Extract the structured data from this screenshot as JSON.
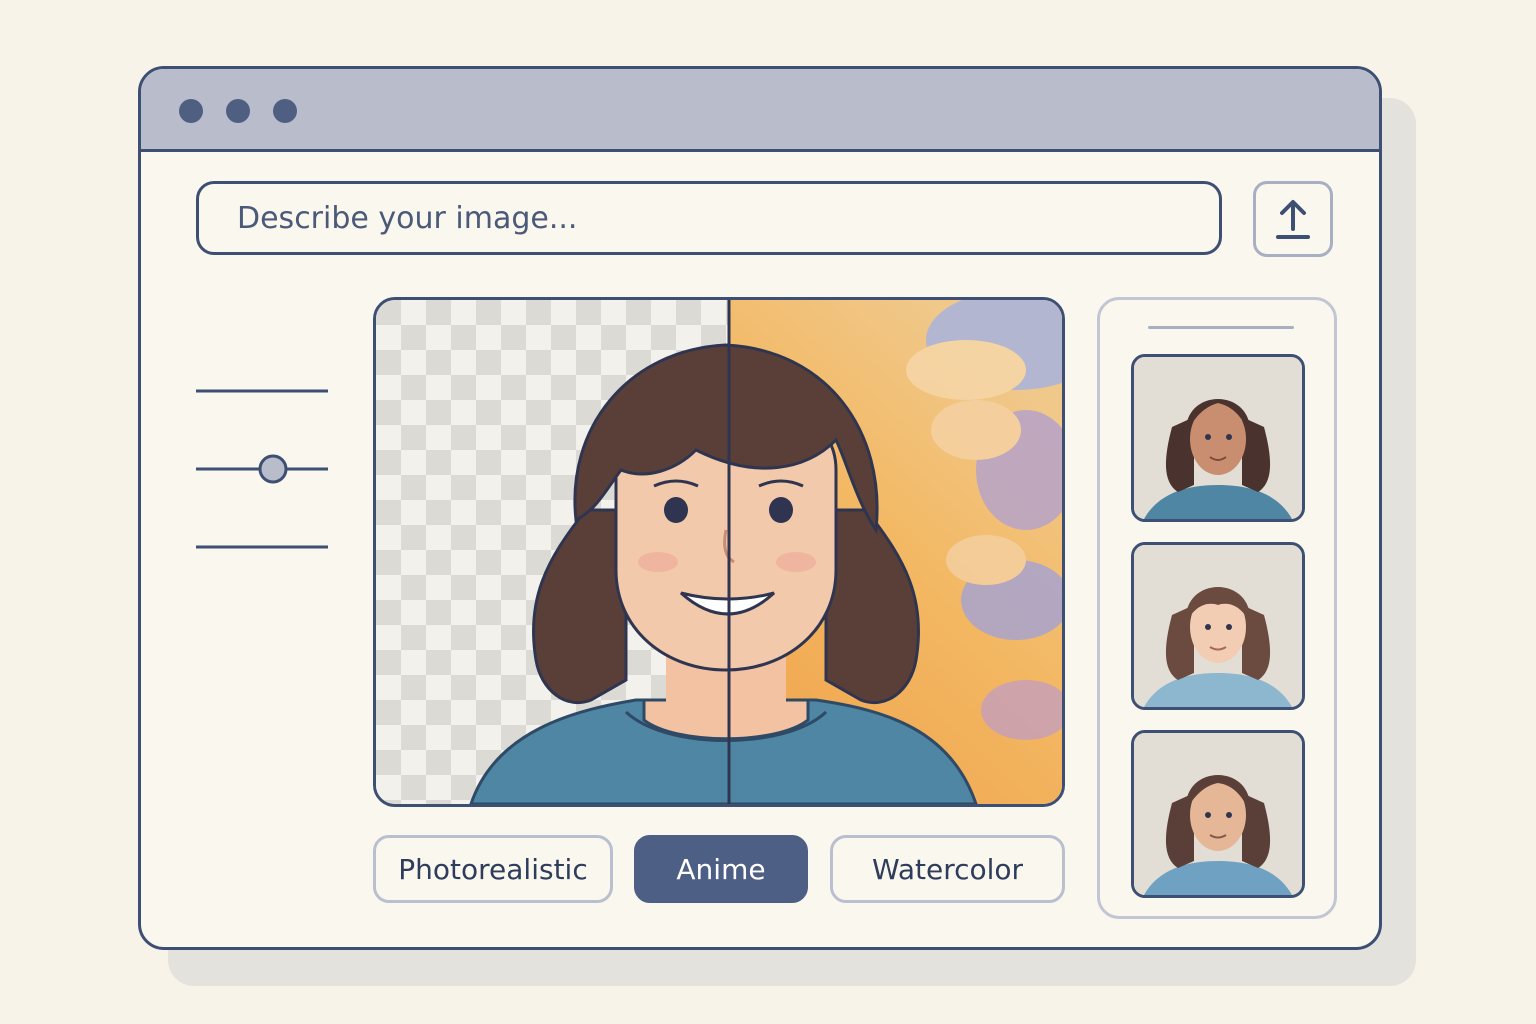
{
  "window": {
    "controls": [
      "close",
      "minimize",
      "maximize"
    ]
  },
  "prompt": {
    "placeholder": "Describe your image..."
  },
  "upload": {
    "icon": "upload-arrow-icon"
  },
  "settings": {
    "slider_count": 3,
    "active_slider_value": 0.6
  },
  "preview": {
    "split": "before-after",
    "left_background": "transparent-checkerboard",
    "right_background": "watercolor-sky"
  },
  "styles": {
    "options": [
      "Photorealistic",
      "Anime",
      "Watercolor"
    ],
    "selected": "Anime"
  },
  "variations": {
    "count": 3,
    "items": [
      "portrait-variation-1",
      "portrait-variation-2",
      "portrait-variation-3"
    ]
  },
  "colors": {
    "background": "#f7f3e8",
    "window_border": "#3d4f73",
    "titlebar": "#b9bdcb",
    "accent": "#4d5f84",
    "shirt": "#4f86a3",
    "hair": "#5a3f38"
  }
}
